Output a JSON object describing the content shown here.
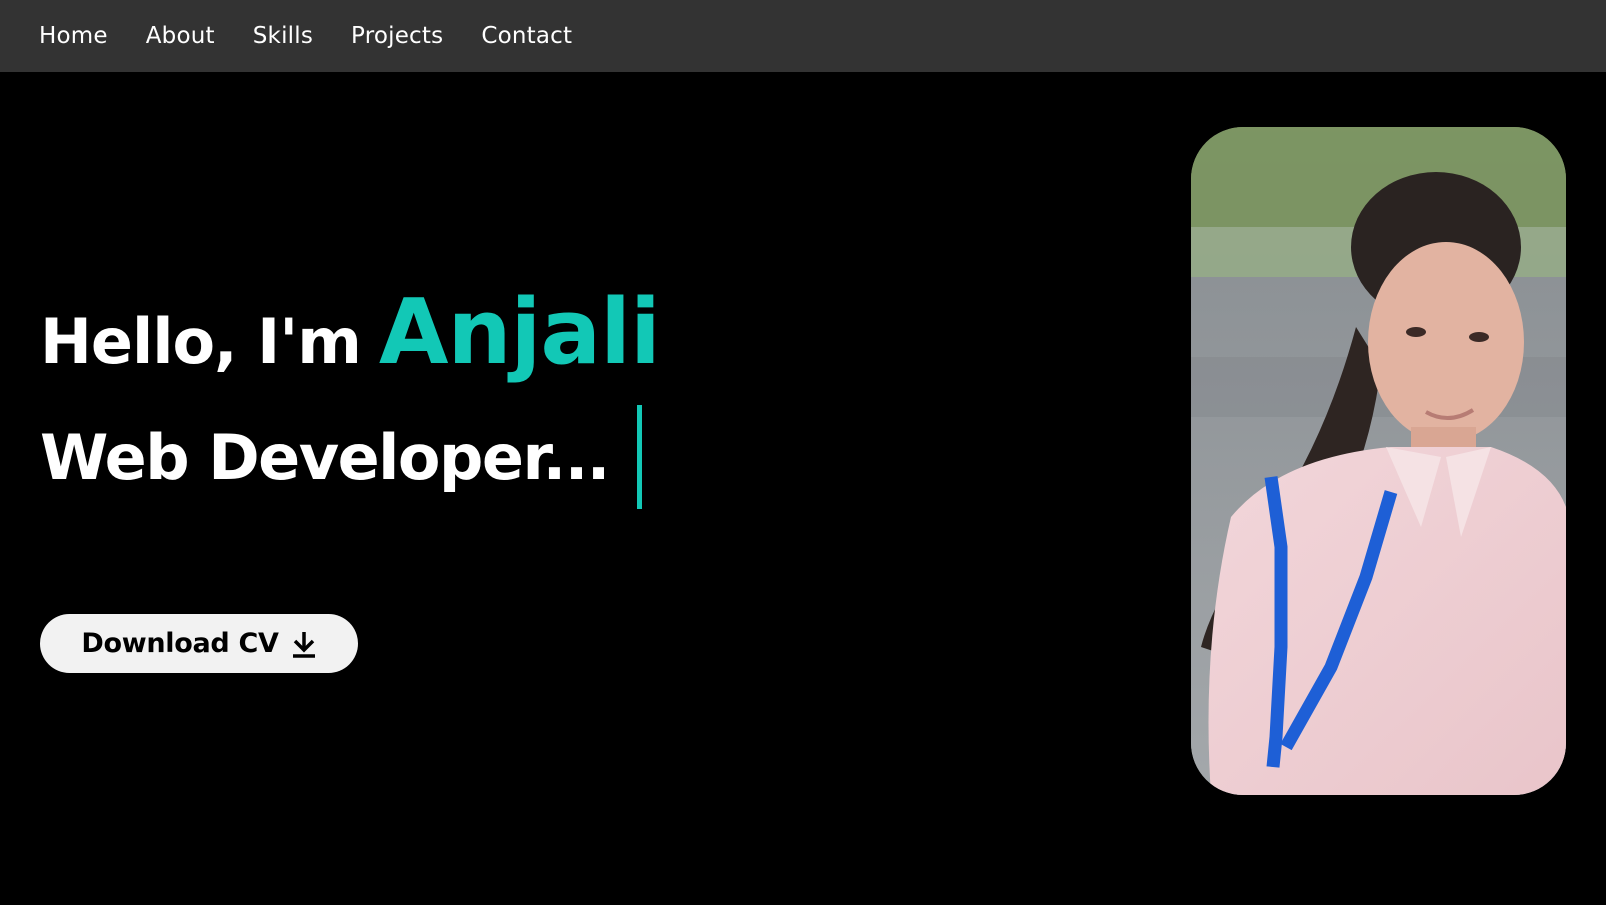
{
  "nav": {
    "items": [
      {
        "label": "Home"
      },
      {
        "label": "About"
      },
      {
        "label": "Skills"
      },
      {
        "label": "Projects"
      },
      {
        "label": "Contact"
      }
    ]
  },
  "hero": {
    "greeting": "Hello, I'm",
    "name": "Anjali",
    "role": "Web Developer...",
    "cv_button": "Download CV",
    "cv_icon": "download-icon"
  },
  "colors": {
    "background": "#000000",
    "navbar": "#333333",
    "accent": "#12c8b6",
    "button": "#f2f2f2"
  }
}
